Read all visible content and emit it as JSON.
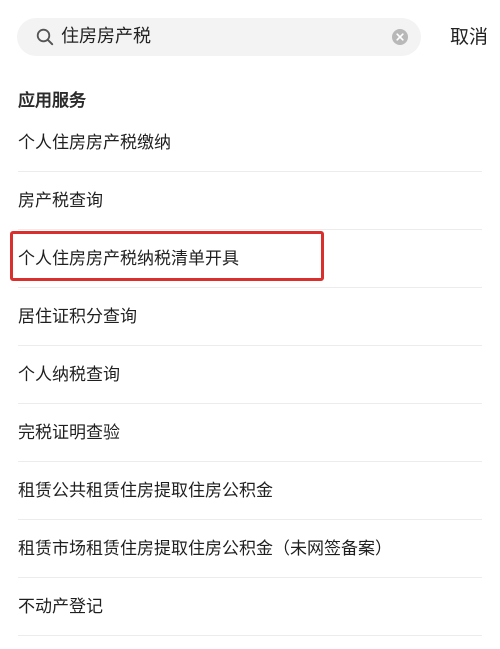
{
  "search": {
    "query": "住房房产税",
    "cancel_label": "取消"
  },
  "section": {
    "title": "应用服务"
  },
  "items": [
    {
      "label": "个人住房房产税缴纳"
    },
    {
      "label": "房产税查询"
    },
    {
      "label": "个人住房房产税纳税清单开具"
    },
    {
      "label": "居住证积分查询"
    },
    {
      "label": "个人纳税查询"
    },
    {
      "label": "完税证明查验"
    },
    {
      "label": "租赁公共租赁住房提取住房公积金"
    },
    {
      "label": "租赁市场租赁住房提取住房公积金（未网签备案）"
    },
    {
      "label": "不动产登记"
    }
  ],
  "colors": {
    "highlight": "#d9302e",
    "search_bg": "#f3f3f3",
    "divider": "#ececec"
  },
  "icons": {
    "search": "search-icon",
    "clear": "clear-icon"
  }
}
